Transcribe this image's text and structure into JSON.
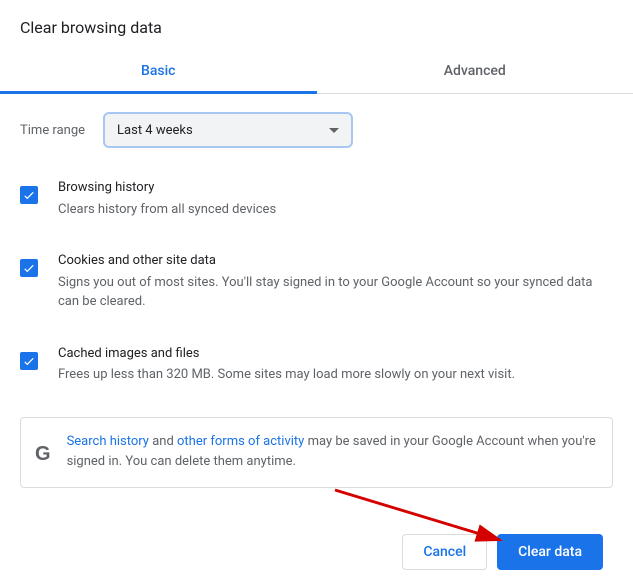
{
  "title": "Clear browsing data",
  "tabs": {
    "basic": "Basic",
    "advanced": "Advanced"
  },
  "time_range": {
    "label": "Time range",
    "value": "Last 4 weeks"
  },
  "options": [
    {
      "title": "Browsing history",
      "desc": "Clears history from all synced devices"
    },
    {
      "title": "Cookies and other site data",
      "desc": "Signs you out of most sites. You'll stay signed in to your Google Account so your synced data can be cleared."
    },
    {
      "title": "Cached images and files",
      "desc": "Frees up less than 320 MB. Some sites may load more slowly on your next visit."
    }
  ],
  "info": {
    "link1": "Search history",
    "text1": " and ",
    "link2": "other forms of activity",
    "text2": " may be saved in your Google Account when you're signed in. You can delete them anytime."
  },
  "buttons": {
    "cancel": "Cancel",
    "clear": "Clear data"
  }
}
